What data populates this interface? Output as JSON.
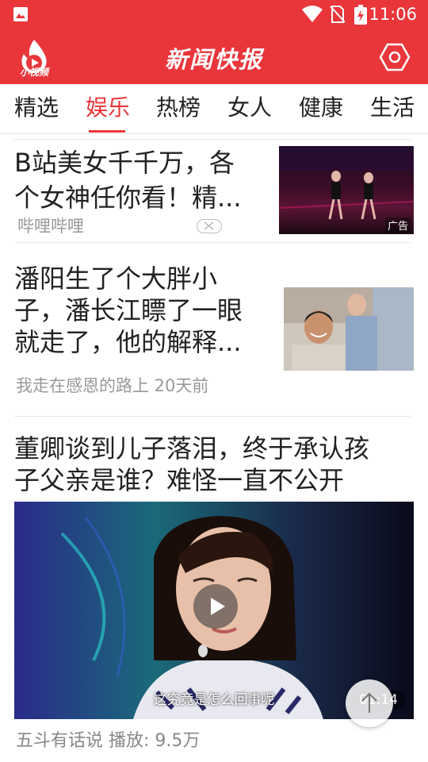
{
  "status_bar": {
    "time": "11:06"
  },
  "header": {
    "logo_text": "小视频",
    "title": "新闻快报",
    "brand_color": "#e9363b"
  },
  "tabs": [
    {
      "label": "精选",
      "active": false
    },
    {
      "label": "娱乐",
      "active": true
    },
    {
      "label": "热榜",
      "active": false
    },
    {
      "label": "女人",
      "active": false
    },
    {
      "label": "健康",
      "active": false
    },
    {
      "label": "生活",
      "active": false
    }
  ],
  "feed": [
    {
      "type": "ad",
      "title_line1": "B站美女千千万，各",
      "title_line2": "个女神任你看！精...",
      "source": "哔哩哔哩",
      "ad_label": "广告"
    },
    {
      "type": "article",
      "title_line1": "潘阳生了个大胖小",
      "title_line2": "子，潘长江瞟了一眼",
      "title_line3": "就走了，他的解释...",
      "meta": "我走在感恩的路上 20天前"
    },
    {
      "type": "video",
      "title_line1": "董卿谈到儿子落泪，终于承认孩",
      "title_line2": "子父亲是谁？难怪一直不公开",
      "subtitle": "这究竟是怎么回事呢",
      "duration": "01:14",
      "meta": "五斗有话说 播放: 9.5万"
    }
  ]
}
